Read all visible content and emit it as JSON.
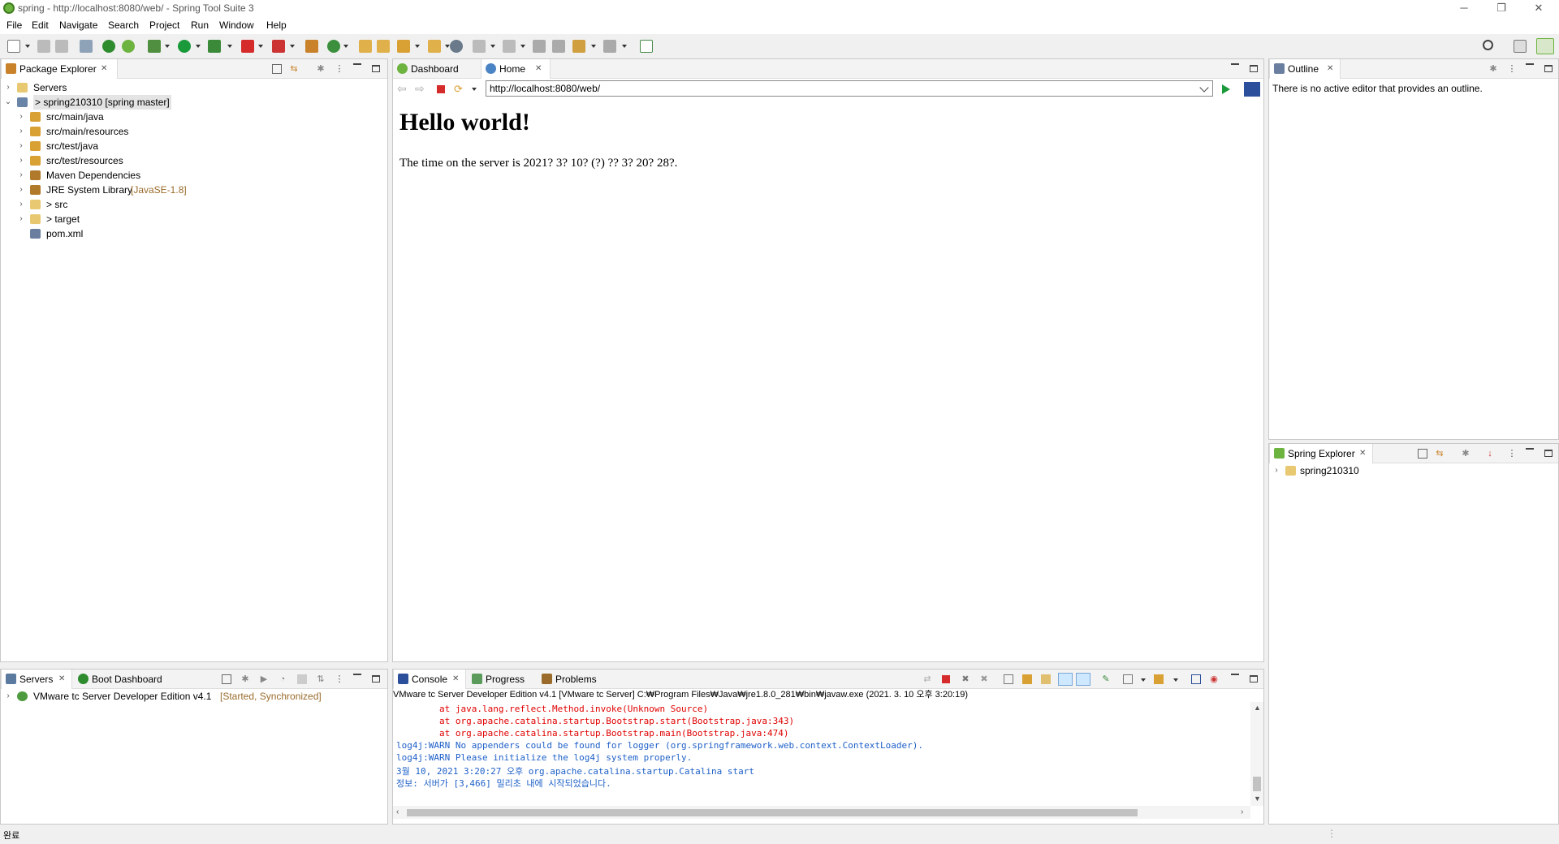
{
  "window": {
    "title": "spring - http://localhost:8080/web/ - Spring Tool Suite 3",
    "controls": [
      "─",
      "❐",
      "✕"
    ]
  },
  "menu": [
    "File",
    "Edit",
    "Navigate",
    "Search",
    "Project",
    "Run",
    "Window",
    "Help"
  ],
  "package_explorer": {
    "tab": "Package Explorer",
    "items": [
      {
        "label": "Servers",
        "decoration": "",
        "level": 0,
        "expanded": false,
        "icon": "folder-icon"
      },
      {
        "label": "> spring210310 [spring master]",
        "decoration": "",
        "level": 0,
        "expanded": true,
        "icon": "project-icon",
        "selected": true
      },
      {
        "label": "src/main/java",
        "decoration": "",
        "level": 1,
        "expanded": false,
        "icon": "package-folder-icon"
      },
      {
        "label": "src/main/resources",
        "decoration": "",
        "level": 1,
        "expanded": false,
        "icon": "package-folder-icon"
      },
      {
        "label": "src/test/java",
        "decoration": "",
        "level": 1,
        "expanded": false,
        "icon": "package-folder-icon"
      },
      {
        "label": "src/test/resources",
        "decoration": "",
        "level": 1,
        "expanded": false,
        "icon": "package-folder-icon"
      },
      {
        "label": "Maven Dependencies",
        "decoration": "",
        "level": 1,
        "expanded": false,
        "icon": "library-icon"
      },
      {
        "label": "JRE System Library",
        "decoration": "[JavaSE-1.8]",
        "level": 1,
        "expanded": false,
        "icon": "library-icon"
      },
      {
        "label": "> src",
        "decoration": "",
        "level": 1,
        "expanded": false,
        "icon": "folder-icon"
      },
      {
        "label": "> target",
        "decoration": "",
        "level": 1,
        "expanded": false,
        "icon": "folder-icon"
      },
      {
        "label": "pom.xml",
        "decoration": "",
        "level": 1,
        "expanded": null,
        "icon": "xml-file-icon"
      }
    ]
  },
  "editor": {
    "tabs": [
      {
        "label": "Dashboard",
        "active": false
      },
      {
        "label": "Home",
        "active": true
      }
    ],
    "url": "http://localhost:8080/web/",
    "page_heading": "Hello world!",
    "page_text": "The time on the server is 2021? 3? 10? (?) ?? 3? 20? 28?."
  },
  "outline": {
    "tab": "Outline",
    "message": "There is no active editor that provides an outline."
  },
  "spring_explorer": {
    "tab": "Spring Explorer",
    "items": [
      {
        "label": "spring210310"
      }
    ]
  },
  "servers": {
    "tabs": [
      {
        "label": "Servers",
        "active": true
      },
      {
        "label": "Boot Dashboard",
        "active": false
      }
    ],
    "items": [
      {
        "label": "VMware tc Server Developer Edition v4.1",
        "decoration": "[Started, Synchronized]"
      }
    ]
  },
  "console": {
    "tabs": [
      {
        "label": "Console",
        "active": true
      },
      {
        "label": "Progress",
        "active": false
      },
      {
        "label": "Problems",
        "active": false
      }
    ],
    "header": "VMware tc Server Developer Edition v4.1 [VMware tc Server] C:₩Program Files₩Java₩jre1.8.0_281₩bin₩javaw.exe  (2021. 3. 10 오후 3:20:19)",
    "lines": [
      {
        "text": "        at java.lang.reflect.Method.invoke(Unknown Source)",
        "color": "#e00000"
      },
      {
        "text": "        at org.apache.catalina.startup.Bootstrap.start(Bootstrap.java:343)",
        "color": "#e00000"
      },
      {
        "text": "        at org.apache.catalina.startup.Bootstrap.main(Bootstrap.java:474)",
        "color": "#e00000"
      },
      {
        "text": "log4j:WARN No appenders could be found for logger (org.springframework.web.context.ContextLoader).",
        "color": "#1e60c8"
      },
      {
        "text": "log4j:WARN Please initialize the log4j system properly.",
        "color": "#1e60c8"
      },
      {
        "text": "3월 10, 2021 3:20:27 오후 org.apache.catalina.startup.Catalina start",
        "color": "#1e60c8"
      },
      {
        "text": "정보: 서버가 [3,466] 밀리초 내에 시작되었습니다.",
        "color": "#1e60c8"
      }
    ]
  },
  "status_bar": {
    "text": "완료"
  },
  "colors": {
    "accent": "#6db33f",
    "selection": "#cde8ff",
    "error": "#e00000",
    "info": "#1e60c8"
  }
}
